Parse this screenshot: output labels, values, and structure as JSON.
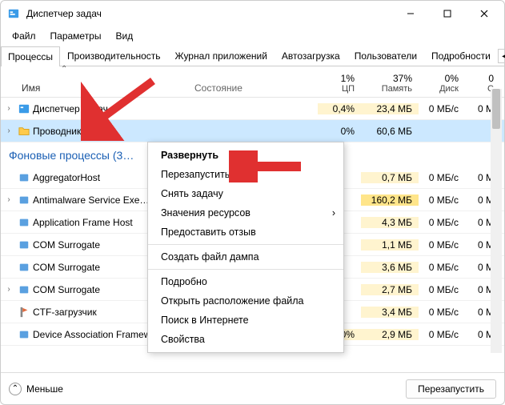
{
  "window": {
    "title": "Диспетчер задач"
  },
  "menu": {
    "file": "Файл",
    "options": "Параметры",
    "view": "Вид"
  },
  "tabs": {
    "t0": "Процессы",
    "t1": "Производительность",
    "t2": "Журнал приложений",
    "t3": "Автозагрузка",
    "t4": "Пользователи",
    "t5": "Подробности"
  },
  "headers": {
    "name": "Имя",
    "status": "Состояние",
    "cpu_pct": "1%",
    "cpu": "ЦП",
    "mem_pct": "37%",
    "mem": "Память",
    "disk_pct": "0%",
    "disk": "Диск",
    "net_pct": "0",
    "net": "С"
  },
  "apps": [
    {
      "name": "Диспетчер задач",
      "cpu": "0,4%",
      "mem": "23,4 МБ",
      "disk": "0 МБ/с",
      "net": "0 М",
      "exp": "›"
    },
    {
      "name": "Проводник",
      "cpu": "0%",
      "mem": "60,6 МБ",
      "disk": "",
      "net": "",
      "exp": "›"
    }
  ],
  "section_bg": "Фоновые процессы (3…",
  "bg": [
    {
      "name": "AggregatorHost",
      "cpu": "",
      "mem": "0,7 МБ",
      "disk": "0 МБ/с",
      "net": "0 М",
      "exp": ""
    },
    {
      "name": "Antimalware Service Exe…",
      "cpu": "",
      "mem": "160,2 МБ",
      "disk": "0 МБ/с",
      "net": "0 М",
      "exp": "›"
    },
    {
      "name": "Application Frame Host",
      "cpu": "",
      "mem": "4,3 МБ",
      "disk": "0 МБ/с",
      "net": "0 М",
      "exp": ""
    },
    {
      "name": "COM Surrogate",
      "cpu": "",
      "mem": "1,1 МБ",
      "disk": "0 МБ/с",
      "net": "0 М",
      "exp": ""
    },
    {
      "name": "COM Surrogate",
      "cpu": "",
      "mem": "3,6 МБ",
      "disk": "0 МБ/с",
      "net": "0 М",
      "exp": ""
    },
    {
      "name": "COM Surrogate",
      "cpu": "",
      "mem": "2,7 МБ",
      "disk": "0 МБ/с",
      "net": "0 М",
      "exp": "›"
    },
    {
      "name": "CTF-загрузчик",
      "cpu": "",
      "mem": "3,4 МБ",
      "disk": "0 МБ/с",
      "net": "0 М",
      "exp": ""
    },
    {
      "name": "Device Association Framework …",
      "cpu": "0%",
      "mem": "2,9 МБ",
      "disk": "0 МБ/с",
      "net": "0 М",
      "exp": ""
    }
  ],
  "ctx": {
    "expand": "Развернуть",
    "restart": "Перезапустить",
    "endtask": "Снять задачу",
    "resvals": "Значения ресурсов",
    "feedback": "Предоставить отзыв",
    "dump": "Создать файл дампа",
    "details": "Подробно",
    "openloc": "Открыть расположение файла",
    "search": "Поиск в Интернете",
    "props": "Свойства"
  },
  "footer": {
    "fewer": "Меньше",
    "restart_btn": "Перезапустить"
  }
}
